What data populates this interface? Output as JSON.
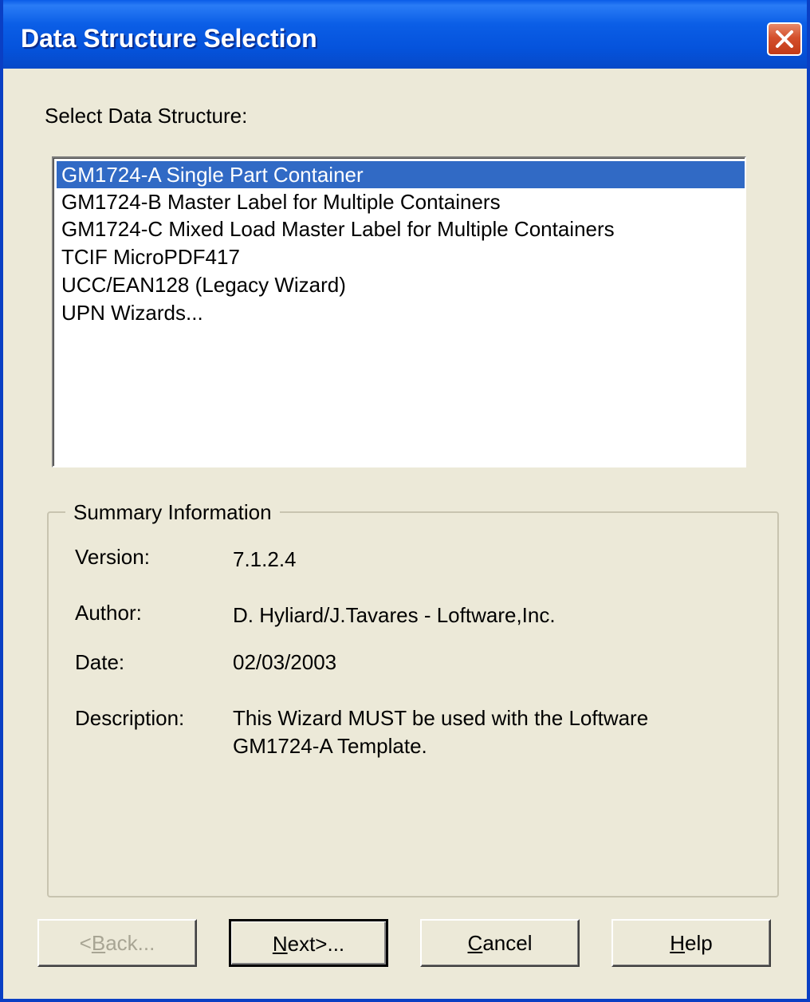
{
  "window": {
    "title": "Data Structure Selection"
  },
  "select_label": "Select Data Structure:",
  "list": {
    "items": [
      "GM1724-A Single Part Container",
      "GM1724-B Master Label for Multiple Containers",
      "GM1724-C Mixed Load Master Label for Multiple Containers",
      "TCIF MicroPDF417",
      "UCC/EAN128 (Legacy Wizard)",
      "UPN Wizards..."
    ],
    "selected_index": 0
  },
  "summary": {
    "title": "Summary Information",
    "version_label": "Version:",
    "version_value": "7.1.2.4",
    "author_label": "Author:",
    "author_value": "D. Hyliard/J.Tavares - Loftware,Inc.",
    "date_label": "Date:",
    "date_value": "02/03/2003",
    "description_label": "Description:",
    "description_line1": "This Wizard MUST be used with the Loftware",
    "description_line2": "GM1724-A Template."
  },
  "buttons": {
    "back": {
      "pre": "<",
      "mnemonic": "B",
      "post": "ack...",
      "enabled": false
    },
    "next": {
      "pre": "",
      "mnemonic": "N",
      "post": "ext>...",
      "enabled": true
    },
    "cancel": {
      "pre": "",
      "mnemonic": "C",
      "post": "ancel",
      "enabled": true
    },
    "help": {
      "pre": "",
      "mnemonic": "H",
      "post": "elp",
      "enabled": true
    }
  },
  "icons": {
    "close": "close-x-icon"
  },
  "colors": {
    "titlebar": "#0553dc",
    "selection": "#316ac5",
    "dialog_bg": "#ece9d8",
    "close_button": "#d4502c"
  }
}
